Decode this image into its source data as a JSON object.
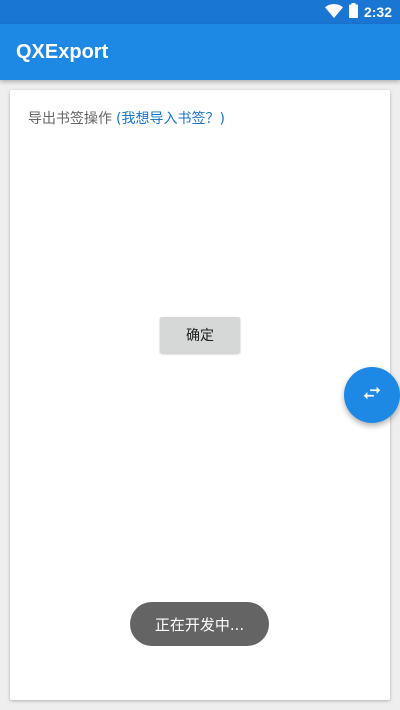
{
  "status_bar": {
    "time": "2:32",
    "wifi_icon": "wifi-icon",
    "battery_icon": "battery-icon"
  },
  "app_bar": {
    "title": "QXExport"
  },
  "card": {
    "export_label": "导出书签操作",
    "import_link": "(我想导入书签？)",
    "confirm_button": "确定"
  },
  "fab": {
    "icon": "swap-icon"
  },
  "toast": {
    "text": "正在开发中..."
  },
  "colors": {
    "status_bar": "#1976d2",
    "app_bar": "#1e88e5",
    "link": "#1976d2",
    "fab": "#1e88e5",
    "toast": "#646464",
    "button": "#d6d7d7"
  }
}
